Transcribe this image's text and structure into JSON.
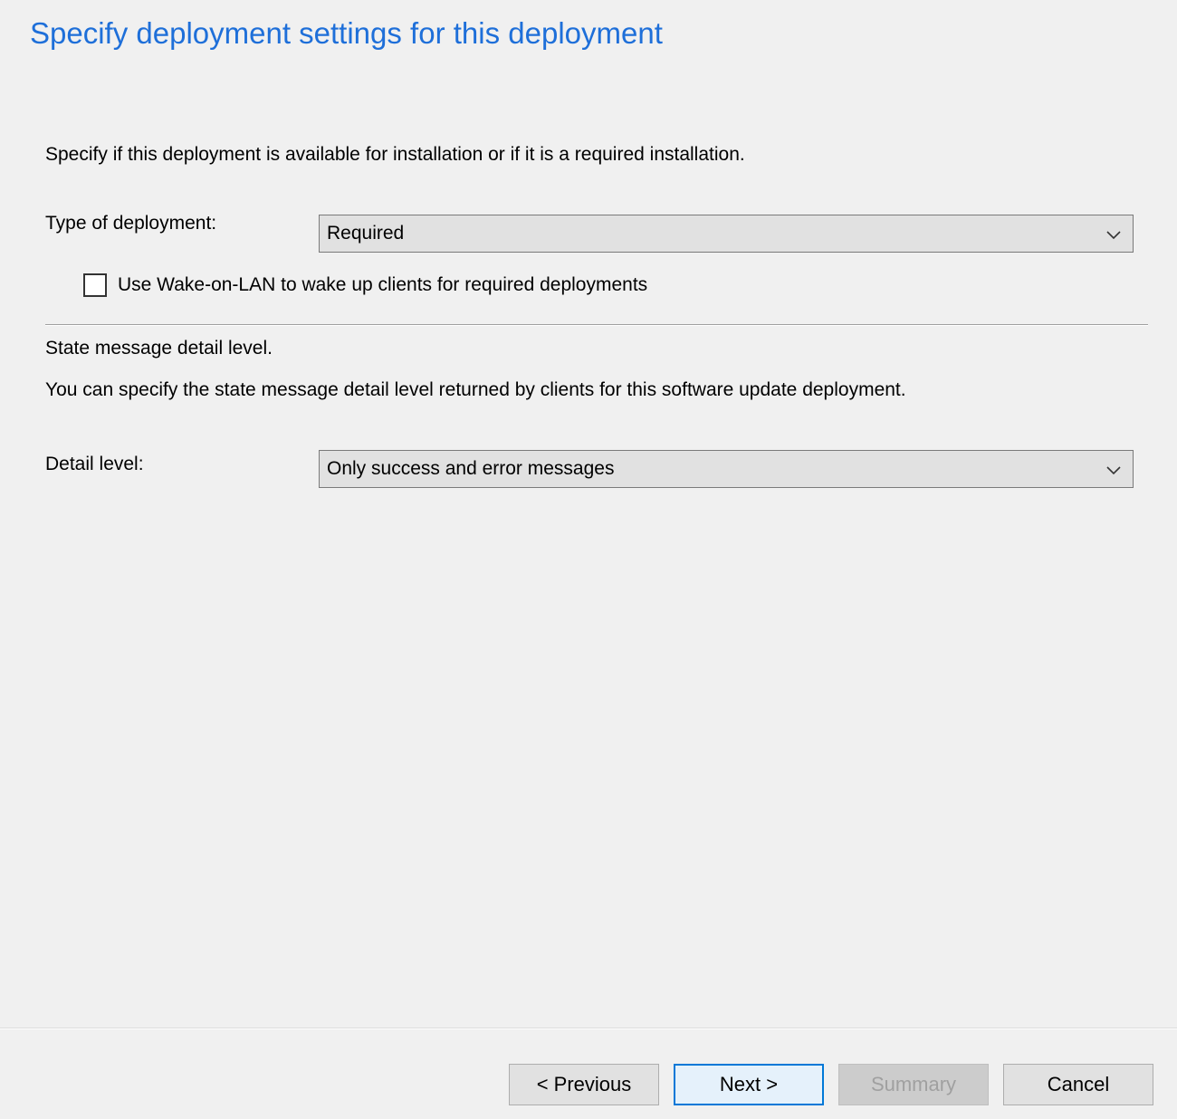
{
  "header": {
    "title": "Specify deployment settings for this deployment"
  },
  "deployment": {
    "intro": "Specify if this deployment is available for installation or if it is a required installation.",
    "type_label": "Type of deployment:",
    "type_value": "Required",
    "wake_on_lan_label": "Use Wake-on-LAN to wake up clients for required deployments",
    "wake_on_lan_checked": false
  },
  "state_message": {
    "heading": "State message detail level.",
    "description": "You can specify the state message detail level returned by clients for this software update deployment.",
    "detail_label": "Detail level:",
    "detail_value": "Only success and error messages"
  },
  "footer": {
    "previous_label": "< Previous",
    "next_label": "Next >",
    "summary_label": "Summary",
    "cancel_label": "Cancel"
  },
  "colors": {
    "title": "#1e6fd9",
    "primary_border": "#0078d7",
    "background": "#f0f0f0"
  }
}
